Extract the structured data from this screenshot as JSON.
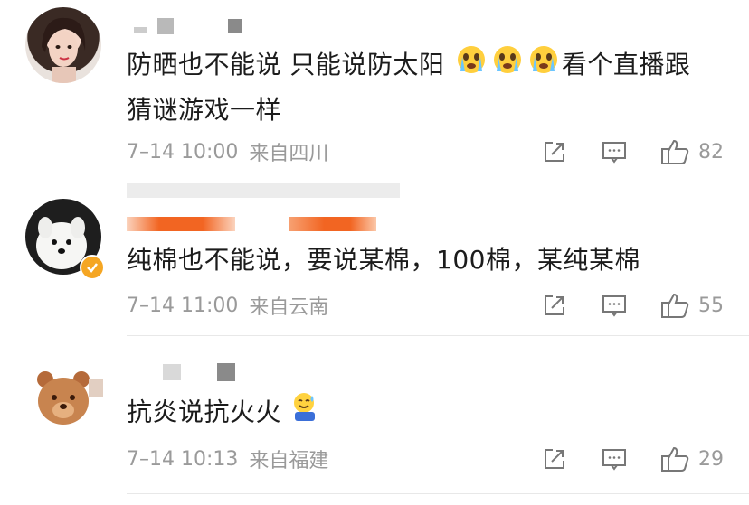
{
  "comments": [
    {
      "text_line1": "防晒也不能说 只能说防太阳",
      "text_line2": "看个直播跟",
      "text_line3": "猜谜游戏一样",
      "time": "7–14 10:00",
      "location": "来自四川",
      "likes": "82",
      "emoji": "crying-face-emoji"
    },
    {
      "text_line1": "纯棉也不能说，要说某棉，100棉，某纯某棉",
      "time": "7–14 11:00",
      "location": "来自云南",
      "likes": "55"
    },
    {
      "text_line1": "抗炎说抗火火",
      "time": "7–14 10:13",
      "location": "来自福建",
      "likes": "29",
      "emoji": "sweat-smile-emoji"
    }
  ],
  "colors": {
    "text": "#1c1c1c",
    "meta": "#9a9a9a",
    "verified_badge": "#f5a623",
    "name_blur_orange": "#f26522"
  }
}
